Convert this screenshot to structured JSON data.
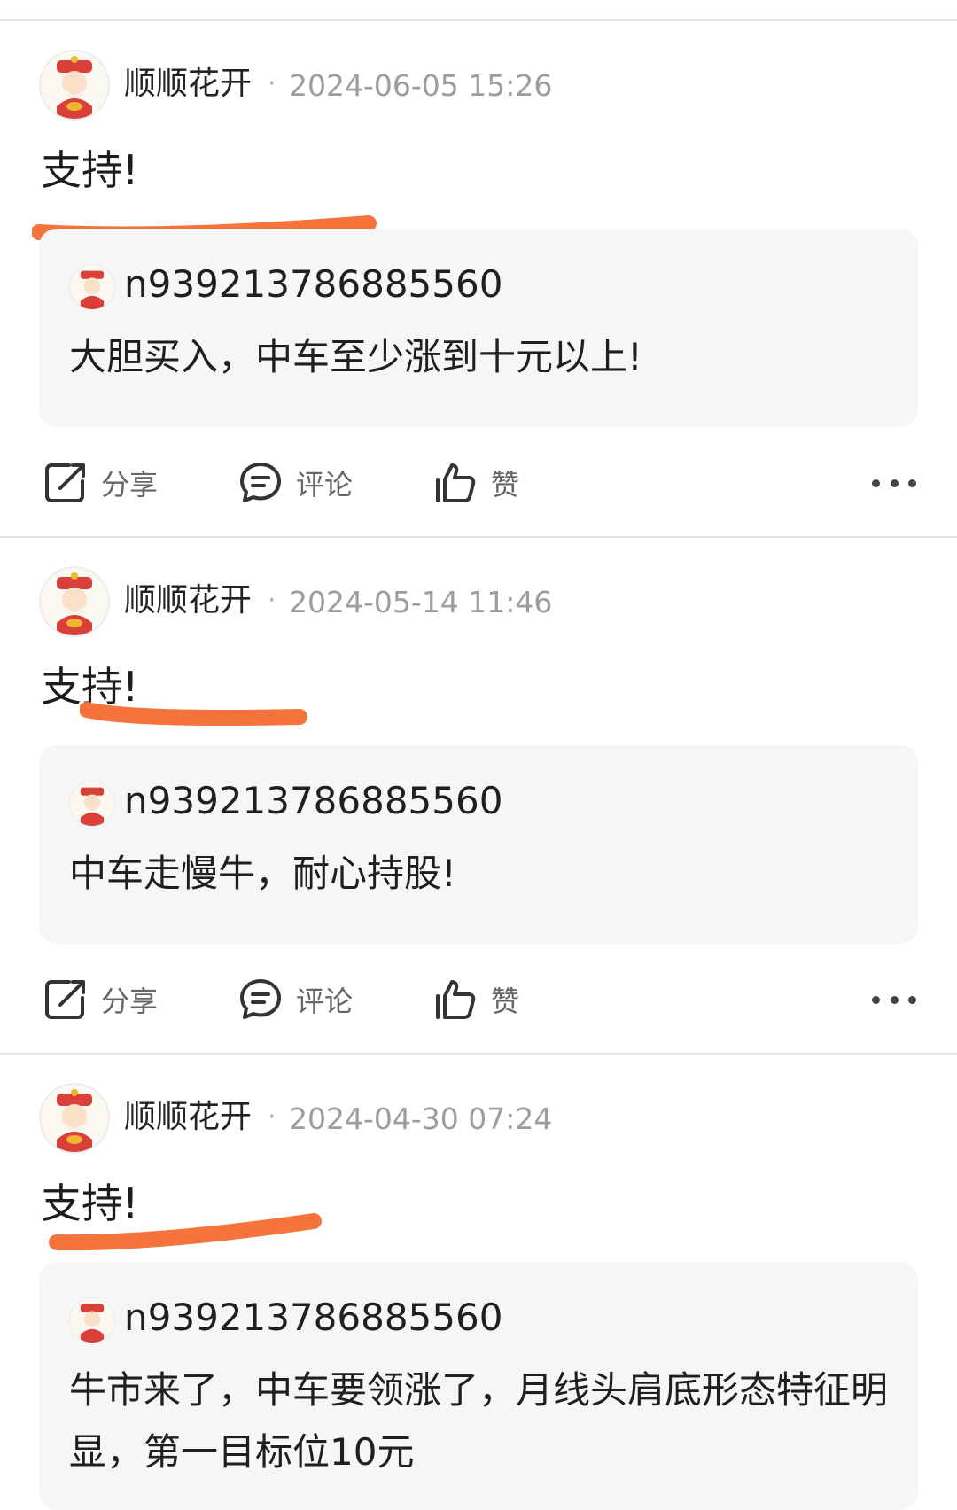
{
  "posts": [
    {
      "author": "顺顺花开",
      "separator": "·",
      "time": "2024-06-05 15:26",
      "content": "支持!",
      "quote": {
        "user": "n939213786885560",
        "text": "大胆买入，中车至少涨到十元以上!"
      },
      "actions": {
        "share": "分享",
        "comment": "评论",
        "like": "赞"
      }
    },
    {
      "author": "顺顺花开",
      "separator": "·",
      "time": "2024-05-14 11:46",
      "content": "支持!",
      "quote": {
        "user": "n939213786885560",
        "text": "中车走慢牛，耐心持股!"
      },
      "actions": {
        "share": "分享",
        "comment": "评论",
        "like": "赞"
      }
    },
    {
      "author": "顺顺花开",
      "separator": "·",
      "time": "2024-04-30 07:24",
      "content": "支持!",
      "quote": {
        "user": "n939213786885560",
        "text": "牛市来了，中车要领涨了，月线头肩底形态特征明显，第一目标位10元"
      },
      "actions": {
        "share": "分享",
        "comment": "评论",
        "like": "赞"
      }
    }
  ],
  "icons": {
    "share": "share-icon",
    "comment": "comment-icon",
    "like": "thumbs-up-icon",
    "more": "more-dots-icon",
    "avatar": "fortune-god-avatar"
  },
  "colors": {
    "highlight_underline": "#f4743c",
    "quote_background": "#f6f6f8",
    "divider": "#e4e4e6",
    "timestamp": "#9c9ca1"
  }
}
